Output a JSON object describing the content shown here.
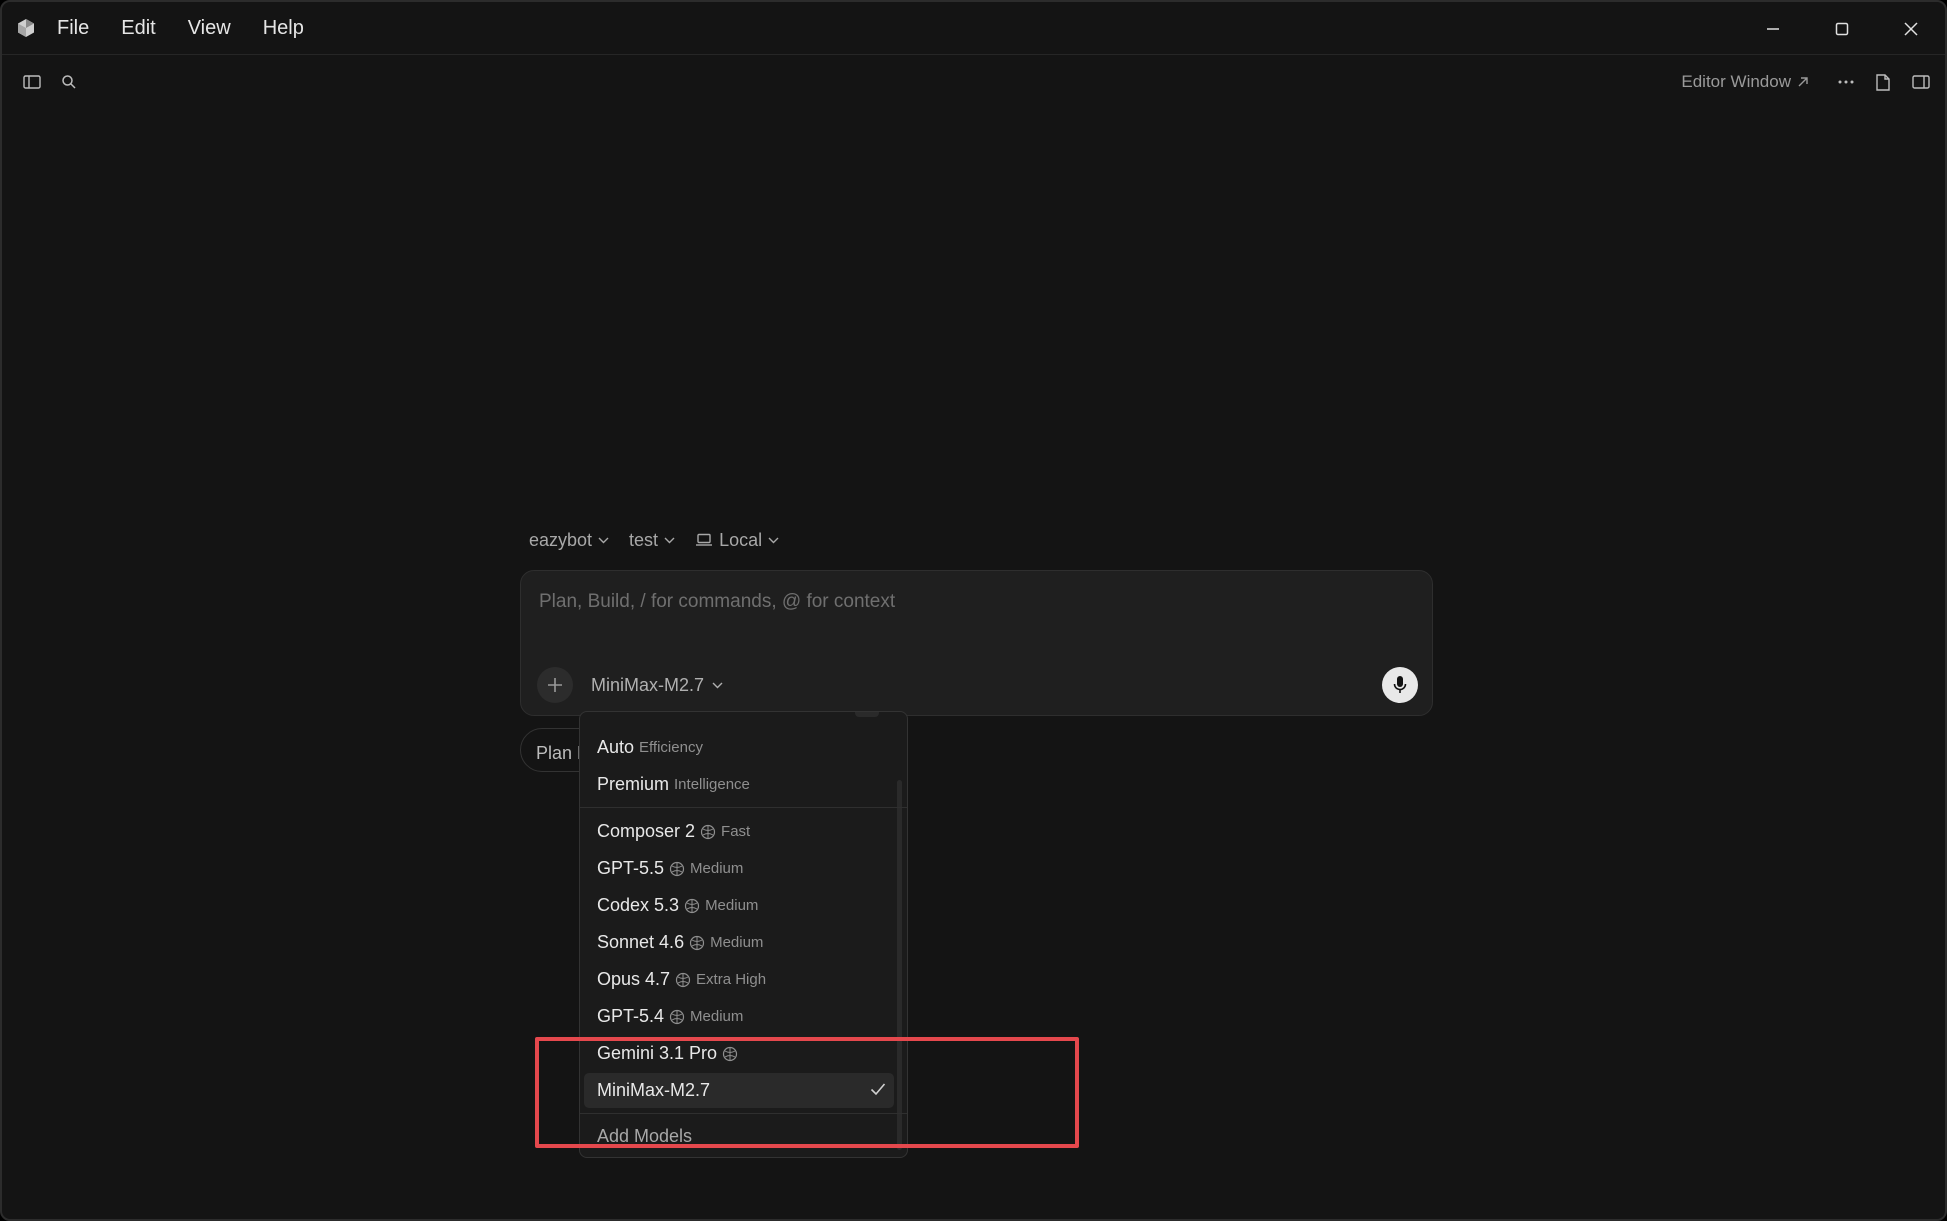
{
  "menubar": {
    "items": [
      "File",
      "Edit",
      "View",
      "Help"
    ],
    "window_controls": [
      "minimize-icon",
      "maximize-icon",
      "close-icon"
    ]
  },
  "toolbar": {
    "left_icons": [
      "sidebar-toggle-icon",
      "search-icon"
    ],
    "editor_window_label": "Editor Window",
    "right_icons": [
      "more-icon",
      "new-file-icon",
      "panel-right-icon"
    ]
  },
  "context": {
    "project": "eazybot",
    "branch": "test",
    "environment": "Local"
  },
  "composer": {
    "placeholder": "Plan, Build, / for commands, @ for context",
    "value": "",
    "selected_model": "MiniMax-M2.7"
  },
  "plan_chip": {
    "label": "Plan Mode"
  },
  "dropdown": {
    "groups": [
      {
        "name": "Auto",
        "tag": "Efficiency"
      },
      {
        "name": "Premium",
        "tag": "Intelligence"
      }
    ],
    "models": [
      {
        "name": "Composer 2",
        "tag": "Fast",
        "thinking": true
      },
      {
        "name": "GPT-5.5",
        "tag": "Medium",
        "thinking": true
      },
      {
        "name": "Codex 5.3",
        "tag": "Medium",
        "thinking": true
      },
      {
        "name": "Sonnet 4.6",
        "tag": "Medium",
        "thinking": true
      },
      {
        "name": "Opus 4.7",
        "tag": "Extra High",
        "thinking": true
      },
      {
        "name": "GPT-5.4",
        "tag": "Medium",
        "thinking": true
      },
      {
        "name": "Gemini 3.1 Pro",
        "tag": "",
        "thinking": true
      },
      {
        "name": "MiniMax-M2.7",
        "tag": "",
        "thinking": false,
        "selected": true
      }
    ],
    "add_models_label": "Add Models"
  },
  "colors": {
    "background": "#141414",
    "surface": "#1f1f1f",
    "highlight": "#e5484d"
  }
}
